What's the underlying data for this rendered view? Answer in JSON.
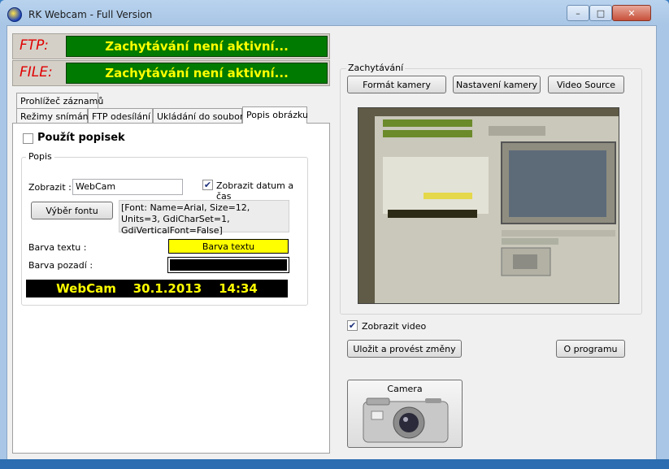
{
  "window": {
    "title": "RK Webcam - Full Version",
    "controls": {
      "minimize": "–",
      "maximize": "□",
      "close": "✕"
    }
  },
  "status": {
    "ftp_label": "FTP:",
    "ftp_value": "Zachytávání není aktivní...",
    "file_label": "FILE:",
    "file_value": "Zachytávání není aktivní..."
  },
  "tabs": {
    "row1": [
      "Prohlížeč záznamů"
    ],
    "row2": [
      "Režimy snímání",
      "FTP odesílání",
      "Ukládání do souboru",
      "Popis obrázku"
    ],
    "active": "Popis obrázku"
  },
  "popis": {
    "use_caption_label": "Použít popisek",
    "use_caption_checked": false,
    "group_label": "Popis",
    "show_label": "Zobrazit :",
    "show_value": "WebCam",
    "show_datetime_label": "Zobrazit datum a čas",
    "show_datetime_checked": true,
    "font_button": "Výběr fontu",
    "font_info": "[Font: Name=Arial, Size=12, Units=3, GdiCharSet=1, GdiVerticalFont=False]",
    "text_color_label": "Barva textu :",
    "text_color_button": "Barva textu",
    "text_color": "#ffff00",
    "bg_color_label": "Barva pozadí :",
    "bg_color": "#000000",
    "preview_text": "WebCam    30.1.2013    14:34"
  },
  "capture": {
    "group_label": "Zachytávání",
    "format_button": "Formát kamery",
    "settings_button": "Nastavení kamery",
    "source_button": "Video Source",
    "show_video_label": "Zobrazit video",
    "show_video_checked": true,
    "save_button": "Uložit a provést změny",
    "about_button": "O programu",
    "camera_button": "Camera"
  },
  "colors": {
    "status_green": "#007a00",
    "status_text": "#ffff00",
    "status_label": "#e00000"
  }
}
